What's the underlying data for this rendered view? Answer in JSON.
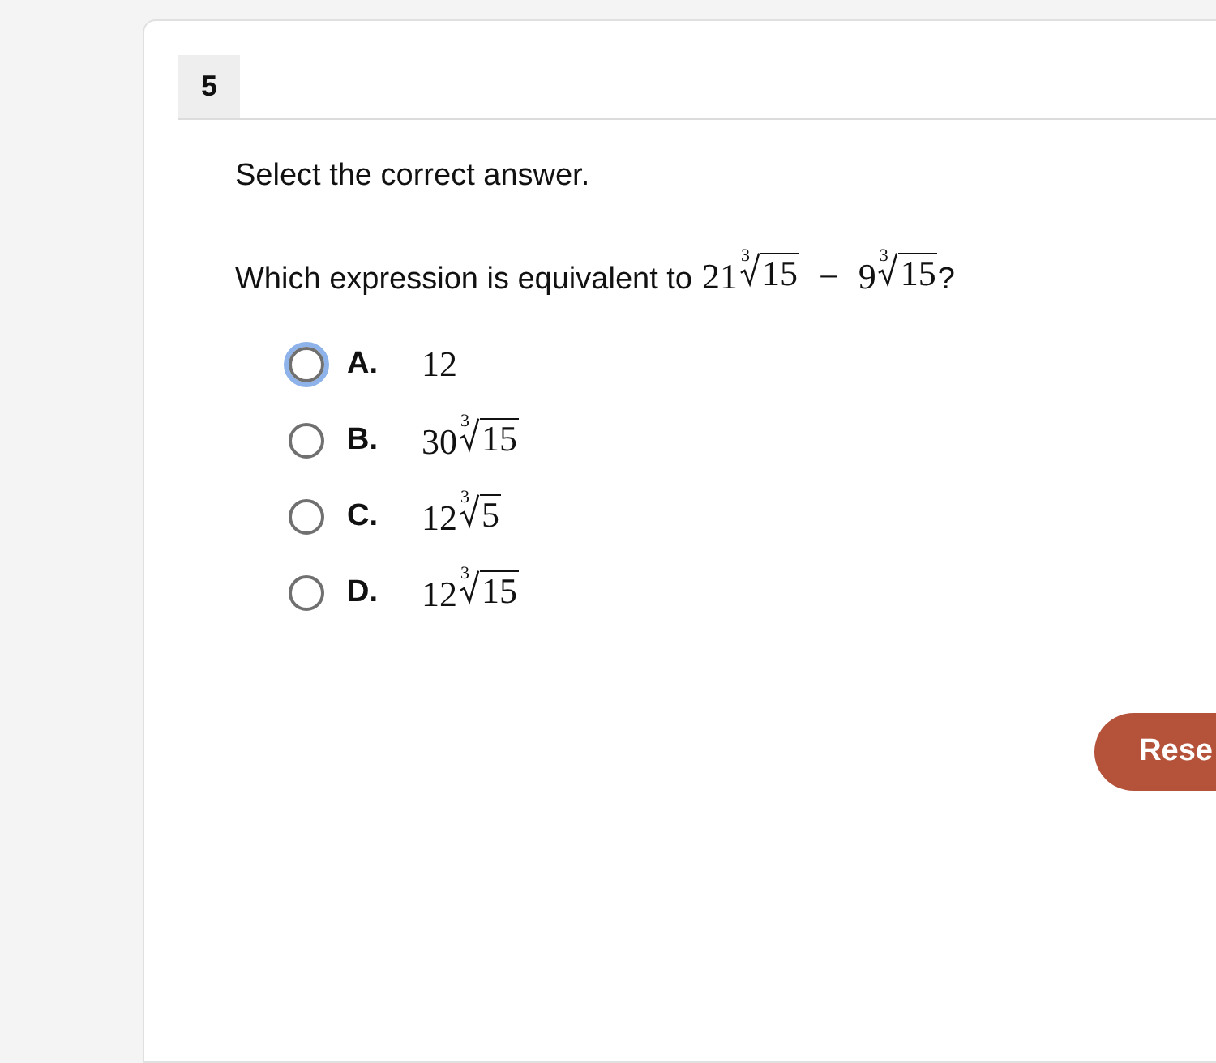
{
  "question_number": "5",
  "instruction": "Select the correct answer.",
  "question": {
    "text": "Which expression is equivalent to ",
    "expression": [
      {
        "kind": "radical",
        "coefficient": "21",
        "index": "3",
        "radicand": "15"
      },
      {
        "kind": "operator",
        "text": "−"
      },
      {
        "kind": "radical",
        "coefficient": "9",
        "index": "3",
        "radicand": "15"
      }
    ],
    "end": "?"
  },
  "options": [
    {
      "letter": "A.",
      "selected": false,
      "focused": true,
      "expression": [
        {
          "kind": "number",
          "text": "12"
        }
      ]
    },
    {
      "letter": "B.",
      "selected": false,
      "focused": false,
      "expression": [
        {
          "kind": "radical",
          "coefficient": "30",
          "index": "3",
          "radicand": "15"
        }
      ]
    },
    {
      "letter": "C.",
      "selected": false,
      "focused": false,
      "expression": [
        {
          "kind": "radical",
          "coefficient": "12",
          "index": "3",
          "radicand": "5"
        }
      ]
    },
    {
      "letter": "D.",
      "selected": false,
      "focused": false,
      "expression": [
        {
          "kind": "radical",
          "coefficient": "12",
          "index": "3",
          "radicand": "15"
        }
      ]
    }
  ],
  "reset_button": "Rese"
}
